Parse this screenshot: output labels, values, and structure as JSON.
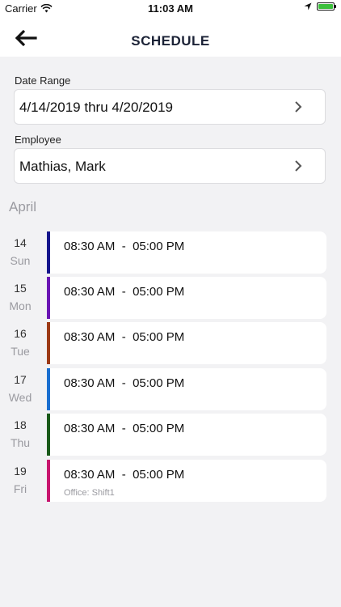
{
  "status_bar": {
    "carrier": "Carrier",
    "time": "11:03 AM",
    "battery_color": "#3cc03c"
  },
  "header": {
    "title": "SCHEDULE",
    "back_icon": "arrow-left-icon"
  },
  "filters": {
    "date_range_label": "Date Range",
    "date_range_value": "4/14/2019 thru 4/20/2019",
    "employee_label": "Employee",
    "employee_value": "Mathias, Mark"
  },
  "month": "April",
  "days": [
    {
      "num": "14",
      "name": "Sun",
      "start": "08:30 AM",
      "end": "05:00 PM",
      "color": "#16168c",
      "sub": ""
    },
    {
      "num": "15",
      "name": "Mon",
      "start": "08:30 AM",
      "end": "05:00 PM",
      "color": "#6a16b4",
      "sub": ""
    },
    {
      "num": "16",
      "name": "Tue",
      "start": "08:30 AM",
      "end": "05:00 PM",
      "color": "#9c3a16",
      "sub": ""
    },
    {
      "num": "17",
      "name": "Wed",
      "start": "08:30 AM",
      "end": "05:00 PM",
      "color": "#1a6fd0",
      "sub": ""
    },
    {
      "num": "18",
      "name": "Thu",
      "start": "08:30 AM",
      "end": "05:00 PM",
      "color": "#1a5a1a",
      "sub": ""
    },
    {
      "num": "19",
      "name": "Fri",
      "start": "08:30 AM",
      "end": "05:00 PM",
      "color": "#c8166e",
      "sub": "Office: Shift1"
    }
  ]
}
